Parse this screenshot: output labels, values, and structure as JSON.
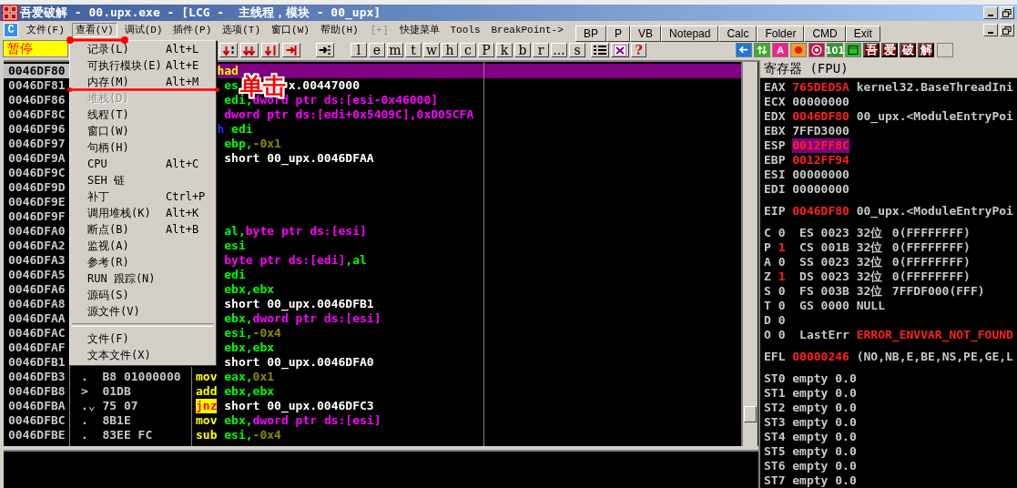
{
  "window": {
    "title": "吾爱破解 - 00.upx.exe - [LCG -  主线程，模块 - 00_upx]"
  },
  "menu_bar": {
    "icon_label": "C",
    "items": [
      {
        "label": "文件(F)",
        "selected": false,
        "disabled": false
      },
      {
        "label": "查看(V)",
        "selected": true,
        "disabled": false
      },
      {
        "label": "调试(D)",
        "selected": false,
        "disabled": false
      },
      {
        "label": "插件(P)",
        "selected": false,
        "disabled": false
      },
      {
        "label": "选项(T)",
        "selected": false,
        "disabled": false
      },
      {
        "label": "窗口(W)",
        "selected": false,
        "disabled": false
      },
      {
        "label": "帮助(H)",
        "selected": false,
        "disabled": false
      },
      {
        "label": "[+]",
        "selected": false,
        "disabled": true
      },
      {
        "label": "快捷菜单",
        "selected": false,
        "disabled": false
      },
      {
        "label": "Tools",
        "selected": false,
        "disabled": false
      },
      {
        "label": "BreakPoint->",
        "selected": false,
        "disabled": false
      }
    ]
  },
  "quick_buttons": [
    "BP",
    "P",
    "VB",
    "Notepad",
    "Calc",
    "Folder",
    "CMD",
    "Exit"
  ],
  "toolbar": {
    "status": "暂停",
    "step_icons": [
      {
        "kind": "step-into"
      },
      {
        "kind": "step-over"
      },
      {
        "kind": "step-down"
      },
      {
        "kind": "return"
      },
      {
        "kind": "goto"
      }
    ],
    "letter_buttons": [
      "l",
      "e",
      "m",
      "t",
      "w",
      "h",
      "c",
      "P",
      "k",
      "b",
      "r",
      "...",
      "s"
    ],
    "tools": [
      {
        "kind": "list"
      },
      {
        "kind": "grid"
      },
      {
        "kind": "help",
        "label": "?"
      }
    ],
    "plugin_icons": [
      {
        "kind": "back"
      },
      {
        "kind": "swap"
      },
      {
        "kind": "letter",
        "label": "A"
      },
      {
        "kind": "record"
      },
      {
        "kind": "target"
      },
      {
        "kind": "letter-green",
        "label": "101"
      },
      {
        "kind": "frame"
      }
    ],
    "brand_buttons": [
      "吾",
      "爱",
      "破",
      "解"
    ]
  },
  "view_menu": [
    {
      "label": "记录(L)",
      "shortcut": "Alt+L",
      "disabled": false
    },
    {
      "label": "可执行模块(E)",
      "shortcut": "Alt+E",
      "disabled": false
    },
    {
      "label": "内存(M)",
      "shortcut": "Alt+M",
      "disabled": false
    },
    {
      "label": "堆栈(D)",
      "disabled": true
    },
    {
      "label": "线程(T)",
      "disabled": false
    },
    {
      "label": "窗口(W)",
      "disabled": false
    },
    {
      "label": "句柄(H)",
      "disabled": false
    },
    {
      "label": "CPU",
      "shortcut": "Alt+C",
      "disabled": false
    },
    {
      "label": "SEH 链",
      "disabled": false
    },
    {
      "label": "补丁",
      "shortcut": "Ctrl+P",
      "disabled": false
    },
    {
      "label": "调用堆栈(K)",
      "shortcut": "Alt+K",
      "disabled": false
    },
    {
      "label": "断点(B)",
      "shortcut": "Alt+B",
      "disabled": false
    },
    {
      "label": "监视(A)",
      "disabled": false
    },
    {
      "label": "参考(R)",
      "disabled": false
    },
    {
      "label": "RUN 跟踪(N)",
      "disabled": false
    },
    {
      "label": "源码(S)",
      "disabled": false
    },
    {
      "label": "源文件(V)",
      "disabled": false
    },
    {
      "label": "文件(F)",
      "disabled": false,
      "separator_before": true
    },
    {
      "label": "文本文件(X)",
      "disabled": false
    }
  ],
  "annotation": {
    "label": "单击"
  },
  "disasm": {
    "rows": [
      {
        "address": "0046DF80",
        "selected": true,
        "mnemonic": {
          "text": "had",
          "kind": "plain"
        }
      },
      {
        "address": "0046DF81",
        "selected": false,
        "operands": [
          {
            "text": "es",
            "kind": "register"
          }
        ],
        "tail": [
          {
            "text": "x.00447000",
            "kind": "text"
          }
        ]
      },
      {
        "address": "0046DF86",
        "selected": false,
        "operands": [
          {
            "text": "edi,",
            "kind": "register"
          },
          {
            "text": "dword ptr ds:[esi-0x46000]",
            "kind": "memory"
          }
        ]
      },
      {
        "address": "0046DF8C",
        "selected": false,
        "operands": [
          {
            "text": "dword ptr ds:[edi+0x5409C],0xD05CFA",
            "kind": "memory"
          }
        ]
      },
      {
        "address": "0046DF96",
        "selected": false,
        "mnemonic": {
          "text": "h",
          "kind": "stack"
        },
        "operands": [
          {
            "text": "edi",
            "kind": "register"
          }
        ]
      },
      {
        "address": "0046DF97",
        "selected": false,
        "operands": [
          {
            "text": "ebp,",
            "kind": "register"
          },
          {
            "text": "-0x1",
            "kind": "number"
          }
        ]
      },
      {
        "address": "0046DF9A",
        "selected": false,
        "operands": [
          {
            "text": "short 00_upx.0046DFAA",
            "kind": "text"
          }
        ]
      },
      {
        "address": "0046DF9C",
        "selected": false
      },
      {
        "address": "0046DF9D",
        "selected": false
      },
      {
        "address": "0046DF9E",
        "selected": false
      },
      {
        "address": "0046DF9F",
        "selected": false
      },
      {
        "address": "0046DFA0",
        "selected": false,
        "operands": [
          {
            "text": "al,",
            "kind": "register"
          },
          {
            "text": "byte ptr ds:[esi]",
            "kind": "memory"
          }
        ]
      },
      {
        "address": "0046DFA2",
        "selected": false,
        "operands": [
          {
            "text": "esi",
            "kind": "register"
          }
        ]
      },
      {
        "address": "0046DFA3",
        "selected": false,
        "operands": [
          {
            "text": "byte ptr ds:[edi]",
            "kind": "memory"
          },
          {
            "text": ",al",
            "kind": "register"
          }
        ]
      },
      {
        "address": "0046DFA5",
        "selected": false,
        "operands": [
          {
            "text": "edi",
            "kind": "register"
          }
        ]
      },
      {
        "address": "0046DFA6",
        "selected": false,
        "operands": [
          {
            "text": "ebx,ebx",
            "kind": "register"
          }
        ]
      },
      {
        "address": "0046DFA8",
        "selected": false,
        "operands": [
          {
            "text": "short 00_upx.0046DFB1",
            "kind": "text"
          }
        ]
      },
      {
        "address": "0046DFAA",
        "selected": false,
        "operands": [
          {
            "text": "ebx,",
            "kind": "register"
          },
          {
            "text": "dword ptr ds:[esi]",
            "kind": "memory"
          }
        ]
      },
      {
        "address": "0046DFAC",
        "selected": false,
        "operands": [
          {
            "text": "esi,",
            "kind": "register"
          },
          {
            "text": "-0x4",
            "kind": "number"
          }
        ]
      },
      {
        "address": "0046DFAF",
        "selected": false,
        "operands": [
          {
            "text": "ebx,ebx",
            "kind": "register"
          }
        ]
      },
      {
        "address": "0046DFB1",
        "selected": false,
        "operands": [
          {
            "text": "short 00_upx.0046DFA0",
            "kind": "text"
          }
        ]
      },
      {
        "address": "0046DFB3",
        "selected": false,
        "marker": ".",
        "hex": "B8 01000000",
        "mnemonic": {
          "text": "mov",
          "kind": "plain"
        },
        "operands": [
          {
            "text": "eax,",
            "kind": "register"
          },
          {
            "text": "0x1",
            "kind": "number"
          }
        ]
      },
      {
        "address": "0046DFB8",
        "selected": false,
        "marker": ">",
        "hex": "01DB",
        "mnemonic": {
          "text": "add",
          "kind": "plain"
        },
        "operands": [
          {
            "text": "ebx,ebx",
            "kind": "register"
          }
        ]
      },
      {
        "address": "0046DFBA",
        "selected": false,
        "marker": ".⌄",
        "hex": "75 07",
        "mnemonic": {
          "text": "jnz",
          "kind": "jump"
        },
        "operands": [
          {
            "text": "short 00_upx.0046DFC3",
            "kind": "text"
          }
        ]
      },
      {
        "address": "0046DFBC",
        "selected": false,
        "marker": ".",
        "hex": "8B1E",
        "mnemonic": {
          "text": "mov",
          "kind": "plain"
        },
        "operands": [
          {
            "text": "ebx,",
            "kind": "register"
          },
          {
            "text": "dword ptr ds:[esi]",
            "kind": "memory"
          }
        ]
      },
      {
        "address": "0046DFBE",
        "selected": false,
        "marker": ".",
        "hex": "83EE FC",
        "mnemonic": {
          "text": "sub",
          "kind": "plain"
        },
        "operands": [
          {
            "text": "esi,",
            "kind": "register"
          },
          {
            "text": "-0x4",
            "kind": "number"
          }
        ]
      }
    ]
  },
  "registers": {
    "title": "寄存器 (FPU)",
    "general": [
      {
        "name": "EAX",
        "value": "765DED5A",
        "changed": true,
        "highlighted": false,
        "comment": "kernel32.BaseThreadIni"
      },
      {
        "name": "ECX",
        "value": "00000000",
        "changed": false,
        "highlighted": false
      },
      {
        "name": "EDX",
        "value": "0046DF80",
        "changed": true,
        "highlighted": false,
        "comment": "00_upx.<ModuleEntryPoi"
      },
      {
        "name": "EBX",
        "value": "7FFD3000",
        "changed": false,
        "highlighted": false
      },
      {
        "name": "ESP",
        "value": "0012FF8C",
        "changed": true,
        "highlighted": true
      },
      {
        "name": "EBP",
        "value": "0012FF94",
        "changed": true,
        "highlighted": false
      },
      {
        "name": "ESI",
        "value": "00000000",
        "changed": false,
        "highlighted": false
      },
      {
        "name": "EDI",
        "value": "00000000",
        "changed": false,
        "highlighted": false
      }
    ],
    "eip": {
      "name": "EIP",
      "value": "0046DF80",
      "changed": true,
      "highlighted": false,
      "comment": "00_upx.<ModuleEntryPoi"
    },
    "flags": [
      {
        "flag": "C",
        "value": "0",
        "changed": false,
        "segment": "ES",
        "selector": "0023",
        "bits": "32位",
        "limit": "0(FFFFFFFF)"
      },
      {
        "flag": "P",
        "value": "1",
        "changed": true,
        "segment": "CS",
        "selector": "001B",
        "bits": "32位",
        "limit": "0(FFFFFFFF)"
      },
      {
        "flag": "A",
        "value": "0",
        "changed": false,
        "segment": "SS",
        "selector": "0023",
        "bits": "32位",
        "limit": "0(FFFFFFFF)"
      },
      {
        "flag": "Z",
        "value": "1",
        "changed": true,
        "segment": "DS",
        "selector": "0023",
        "bits": "32位",
        "limit": "0(FFFFFFFF)"
      },
      {
        "flag": "S",
        "value": "0",
        "changed": false,
        "segment": "FS",
        "selector": "003B",
        "bits": "32位",
        "limit": "7FFDF000(FFF)"
      },
      {
        "flag": "T",
        "value": "0",
        "changed": false,
        "segment": "GS",
        "selector": "0000",
        "bits": "NULL"
      },
      {
        "flag": "D",
        "value": "0",
        "changed": false
      },
      {
        "flag": "O",
        "value": "0",
        "changed": false,
        "label": "LastErr",
        "error": "ERROR_ENVVAR_NOT_FOUND"
      }
    ],
    "efl": {
      "name": "EFL",
      "value": "00000246",
      "changed": true,
      "highlighted": false,
      "comment": "(NO,NB,E,BE,NS,PE,GE,L"
    },
    "fpu": [
      {
        "name": "ST0",
        "tag": "empty",
        "value": "0.0"
      },
      {
        "name": "ST1",
        "tag": "empty",
        "value": "0.0"
      },
      {
        "name": "ST2",
        "tag": "empty",
        "value": "0.0"
      },
      {
        "name": "ST3",
        "tag": "empty",
        "value": "0.0"
      },
      {
        "name": "ST4",
        "tag": "empty",
        "value": "0.0"
      },
      {
        "name": "ST5",
        "tag": "empty",
        "value": "0.0"
      },
      {
        "name": "ST6",
        "tag": "empty",
        "value": "0.0"
      },
      {
        "name": "ST7",
        "tag": "empty",
        "value": "0.0"
      }
    ]
  }
}
